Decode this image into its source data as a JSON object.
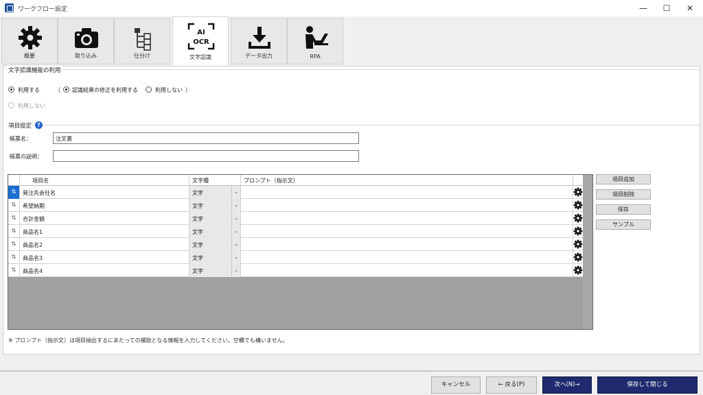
{
  "window": {
    "title": "ワークフロー設定",
    "minimize": "—",
    "maximize": "☐",
    "close": "✕"
  },
  "tabs": [
    {
      "label": "概要",
      "icon": "gear-icon"
    },
    {
      "label": "取り込み",
      "icon": "camera-icon"
    },
    {
      "label": "仕分け",
      "icon": "tree-icon"
    },
    {
      "label": "文字認識",
      "icon": "ai-ocr-icon",
      "icon_text_top": "AI",
      "icon_text_bottom": "OCR",
      "active": true
    },
    {
      "label": "データ出力",
      "icon": "download-icon"
    },
    {
      "label": "RPA",
      "icon": "person-laptop-icon"
    }
  ],
  "ocr_usage": {
    "title": "文字認識機能の利用",
    "use_label": "利用する",
    "paren_open": "（",
    "correction_use": "認識結果の修正を利用する",
    "correction_nouse": "利用しない",
    "paren_close": "）",
    "nouse_label": "利用しない"
  },
  "item_settings": {
    "title": "項目設定",
    "help": "?",
    "form_name_label": "帳票名：",
    "form_name_value": "注文書",
    "form_desc_label": "帳票の説明：",
    "form_desc_value": ""
  },
  "grid": {
    "headers": {
      "name": "項目名",
      "type": "文字種",
      "prompt": "プロンプト（指示文）"
    },
    "drag_glyph": "⇅",
    "rows": [
      {
        "name": "発注先会社名",
        "type": "文字",
        "prompt": ""
      },
      {
        "name": "希望納期",
        "type": "文字",
        "prompt": ""
      },
      {
        "name": "合計金額",
        "type": "文字",
        "prompt": ""
      },
      {
        "name": "商品名1",
        "type": "文字",
        "prompt": ""
      },
      {
        "name": "商品名2",
        "type": "文字",
        "prompt": ""
      },
      {
        "name": "商品名3",
        "type": "文字",
        "prompt": ""
      },
      {
        "name": "商品名4",
        "type": "文字",
        "prompt": ""
      }
    ]
  },
  "side_buttons": {
    "add": "項目追加",
    "delete": "項目削除",
    "save": "保存",
    "sample": "サンプル"
  },
  "note": "※ プロンプト（指示文）は項目抽出するにあたっての補助となる情報を入力してください。空欄でも構いません。",
  "footer": {
    "cancel": "キャンセル",
    "back": "← 戻る(P)",
    "next": "次へ(N)→",
    "save_close": "保存して閉じる"
  },
  "colors": {
    "accent": "#1f2b6e",
    "selection": "#1a6fd1",
    "grid_bg": "#a0a0a0"
  }
}
